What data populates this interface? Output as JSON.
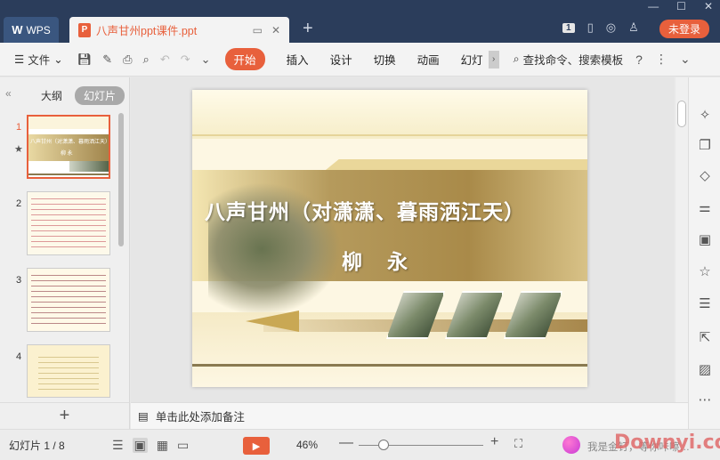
{
  "titlebar": {
    "app_tab_label": "WPS",
    "doc_tab_title": "八声甘州ppt课件.ppt",
    "new_tab_symbol": "+",
    "badge_count": "1",
    "login_label": "未登录"
  },
  "menubar": {
    "file_label": "文件",
    "start_label": "开始",
    "items": [
      "插入",
      "设计",
      "切换",
      "动画",
      "幻灯"
    ],
    "search_label": "查找命令、搜索模板",
    "help_symbol": "?"
  },
  "leftpanel": {
    "tab_outline": "大纲",
    "tab_slides": "幻灯片",
    "slide_numbers": [
      "1",
      "2",
      "3",
      "4"
    ],
    "thumb1_title": "八声甘州（对潇潇、暮雨洒江天）",
    "thumb1_author": "柳 永",
    "add_symbol": "+"
  },
  "slide": {
    "title": "八声甘州（对潇潇、暮雨洒江天）",
    "author": "柳 永"
  },
  "notes": {
    "placeholder": "单击此处添加备注"
  },
  "status": {
    "slide_count": "幻灯片 1 / 8",
    "zoom": "46%",
    "assistant_text": "我是金钉，等你咔嚓…",
    "watermark": "Downyi.com"
  },
  "colors": {
    "accent": "#e8603c",
    "titlebar": "#2b3d5b"
  }
}
